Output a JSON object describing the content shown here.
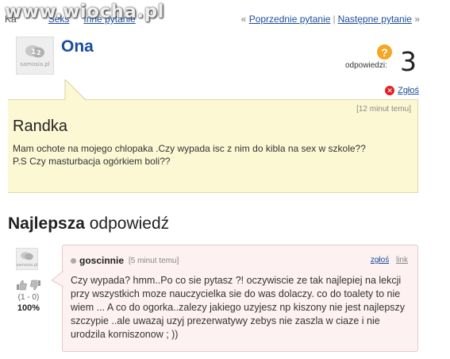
{
  "nav": {
    "breadcrumb_start": "Ka",
    "breadcrumb_mid": "Seks",
    "breadcrumb_end": "Inne pytanie",
    "watermark": "www.wiocha.pl",
    "prev_label": "Poprzednie pytanie",
    "next_label": "Następne pytanie",
    "separator": "|",
    "prev_arrow": "«",
    "next_arrow": "»"
  },
  "question": {
    "author": "Ona",
    "avatar_label": "samosia.pl",
    "answers_label": "odpowiedzi:",
    "answers_count": "3",
    "question_icon": "?",
    "report_label": "Zgłoś",
    "time": "[12 minut temu]",
    "title": "Randka",
    "body_line1": "Mam ochote na mojego chlopaka .Czy wypada isc z nim do kibla na sex w szkole??",
    "body_line2": "P.S Czy masturbacja ogórkiem boli??"
  },
  "best_answer": {
    "heading_bold": "Najlepsza",
    "heading_rest": "odpowiedź",
    "author": "goscinnie",
    "time": "[5 minut temu]",
    "report_label": "zgłoś",
    "link_label": "link",
    "avatar_label": "samosia.pl",
    "votes_count": "(1 - 0)",
    "votes_percent": "100%",
    "text": "Czy wypada? hmm..Po co sie pytasz ?! oczywiscie ze tak najlepiej na lekcji przy wszystkich moze nauczycielka sie do was dolaczy. co do toalety to nie wiem ... A co do ogorka..zalezy jakiego uzyjesz np kiszony nie jest najlepszy szczypie ..ale uwazaj uzyj prezerwatywy zebys nie zaszla w ciaze i nie urodzila korniszonow ; ))"
  },
  "colors": {
    "link": "#1a4e9c",
    "question_bg": "#fdf8d4",
    "answer_bg": "#fdf1f1",
    "question_icon": "#f5a623",
    "report_icon": "#dd2222"
  }
}
